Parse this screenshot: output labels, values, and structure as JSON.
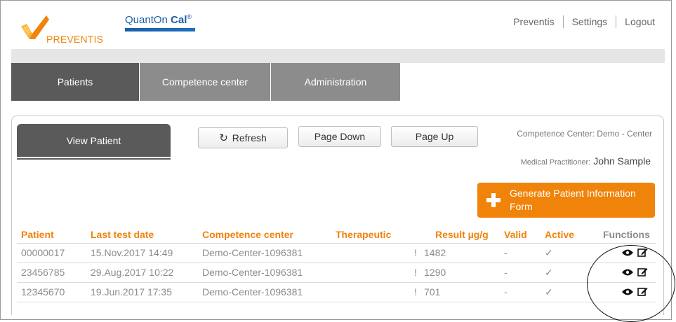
{
  "brand": {
    "logo_text": "PREVENTIS",
    "product_name": "QuantOn ",
    "product_bold": "Cal",
    "product_reg": "®",
    "orange": "#f0830a",
    "blue": "#1a5fa6"
  },
  "top_links": [
    "Preventis",
    "Settings",
    "Logout"
  ],
  "main_tabs": [
    "Patients",
    "Competence center",
    "Administration"
  ],
  "toolbar": {
    "view_patient": "View Patient",
    "refresh": "Refresh",
    "page_down": "Page Down",
    "page_up": "Page Up"
  },
  "info": {
    "competence_center": "Competence Center: Demo - Center",
    "mp_label": "Medical Practitioner:",
    "mp_name": "John Sample"
  },
  "generate_button": "Generate Patient Information Form",
  "table": {
    "headers": {
      "patient": "Patient",
      "last_test_date": "Last test date",
      "competence_center": "Competence center",
      "therapeutic": "Therapeutic",
      "result": "Result µg/g",
      "valid": "Valid",
      "active": "Active",
      "functions": "Functions"
    },
    "rows": [
      {
        "patient": "00000017",
        "date": "15.Nov.2017 14:49",
        "center": "Demo-Center-1096381",
        "therapeutic": "",
        "flag": "!",
        "result": "1482",
        "valid": "-",
        "active": "✓"
      },
      {
        "patient": "23456785",
        "date": "29.Aug.2017 10:22",
        "center": "Demo-Center-1096381",
        "therapeutic": "",
        "flag": "!",
        "result": "1290",
        "valid": "-",
        "active": "✓"
      },
      {
        "patient": "12345670",
        "date": "19.Jun.2017 17:35",
        "center": "Demo-Center-1096381",
        "therapeutic": "",
        "flag": "!",
        "result": "701",
        "valid": "-",
        "active": "✓"
      }
    ]
  }
}
